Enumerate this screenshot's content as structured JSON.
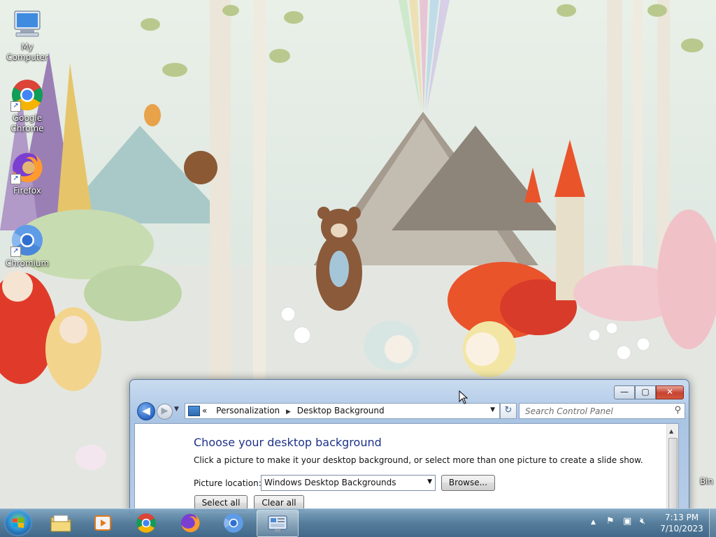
{
  "desktop": {
    "icons": [
      {
        "label": "My Computer",
        "icon": "computer-icon"
      },
      {
        "label": "Google Chrome",
        "label_line1": "Google",
        "label_line2": "Chrome",
        "icon": "chrome-icon"
      },
      {
        "label": "Firefox",
        "icon": "firefox-icon"
      },
      {
        "label": "Chromium",
        "icon": "chromium-icon"
      }
    ],
    "recycle_bin_partial_label": "Bin"
  },
  "window": {
    "controls": {
      "minimize": "—",
      "maximize": "▢",
      "close": "✕"
    },
    "nav": {
      "back_glyph": "◀",
      "forward_glyph": "▶",
      "refresh_glyph": "↻"
    },
    "address": {
      "overflow": "«",
      "crumbs": [
        "Personalization",
        "Desktop Background"
      ],
      "separator": "▶"
    },
    "search": {
      "placeholder": "Search Control Panel",
      "icon": "search-icon"
    },
    "content": {
      "title": "Choose your desktop background",
      "description": "Click a picture to make it your desktop background, or select more than one picture to create a slide show.",
      "picture_location_label": "Picture location:",
      "picture_location_value": "Windows Desktop Backgrounds",
      "browse_label": "Browse...",
      "select_all_label": "Select all",
      "clear_all_label": "Clear all"
    }
  },
  "taskbar": {
    "buttons": [
      {
        "name": "explorer",
        "icon": "folder-icon"
      },
      {
        "name": "media-player",
        "icon": "media-player-icon"
      },
      {
        "name": "chrome",
        "icon": "chrome-icon"
      },
      {
        "name": "firefox",
        "icon": "firefox-icon"
      },
      {
        "name": "chromium",
        "icon": "chromium-icon"
      },
      {
        "name": "control-panel",
        "icon": "control-panel-icon",
        "active": true
      }
    ],
    "tray": {
      "show_hidden": "▲"
    },
    "clock": {
      "time": "7:13 PM",
      "date": "7/10/2023"
    }
  },
  "colors": {
    "heading": "#1e3287",
    "taskbar": "#4e7898",
    "close_button": "#c6422f"
  }
}
